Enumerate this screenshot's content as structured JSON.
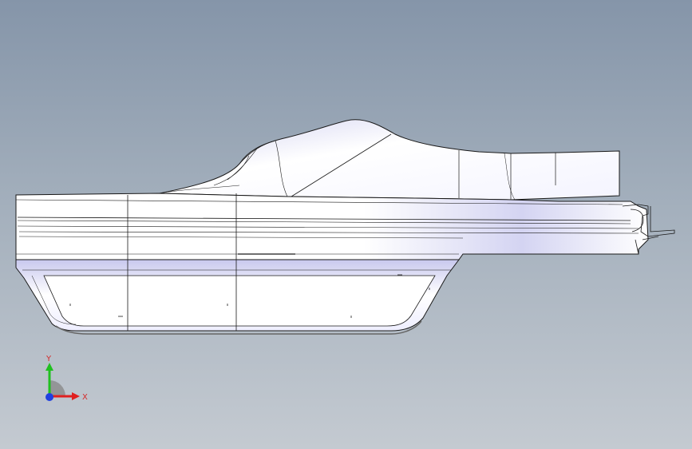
{
  "viewport": {
    "background_top": "#8595a9",
    "background_bottom": "#c4cad1"
  },
  "model": {
    "surface_color": "#ffffff",
    "edge_color": "#1a1a1a",
    "shade_color": "#b8b8e8"
  },
  "triad": {
    "x_label": "X",
    "y_label": "Y",
    "x_color": "#e02020",
    "y_color": "#20c020",
    "z_color": "#2040e0"
  }
}
